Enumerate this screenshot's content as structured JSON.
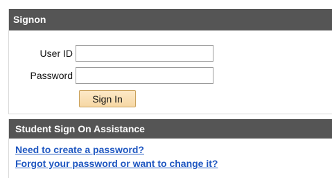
{
  "signon": {
    "title": "Signon",
    "user_id_label": "User ID",
    "user_id_value": "",
    "password_label": "Password",
    "password_value": "",
    "sign_in_label": "Sign In"
  },
  "assistance": {
    "title": "Student Sign On Assistance",
    "links": [
      "Need to create a password?",
      "Forgot your password or want to change it?"
    ]
  },
  "colors": {
    "header_background": "#555555",
    "header_text": "#ffffff",
    "link": "#1f57c1",
    "button_background": "#f6d7a4"
  }
}
